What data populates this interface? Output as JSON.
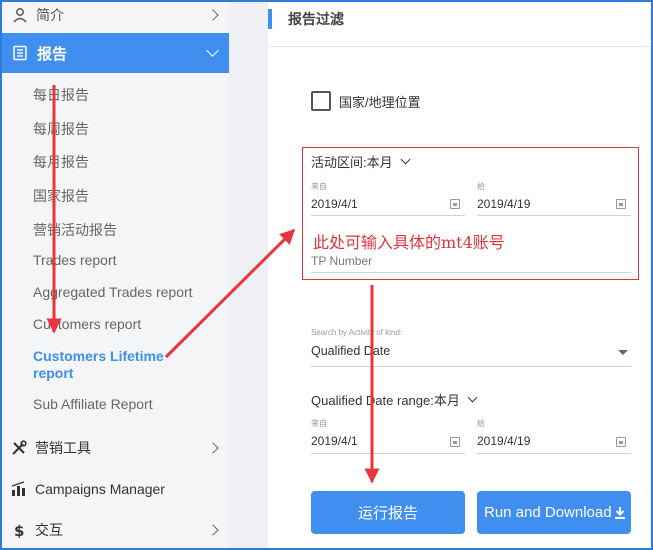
{
  "sidebar": {
    "top_item": {
      "label": "简介",
      "icon": "user-icon"
    },
    "active_item": {
      "label": "报告",
      "icon": "report-icon"
    },
    "sub_items": [
      {
        "label": "每日报告"
      },
      {
        "label": "每周报告"
      },
      {
        "label": "每月报告"
      },
      {
        "label": "国家报告"
      },
      {
        "label": "营销活动报告"
      },
      {
        "label": "Trades report"
      },
      {
        "label": "Aggregated Trades report"
      },
      {
        "label": "Customers report"
      },
      {
        "label": "Customers Lifetime report"
      },
      {
        "label": "Sub Affiliate Report"
      }
    ],
    "bottom_items": [
      {
        "label": "营销工具",
        "icon": "tools-icon"
      },
      {
        "label": "Campaigns Manager",
        "icon": "bar-chart-icon"
      },
      {
        "label": "交互",
        "icon": "dollar-icon"
      }
    ]
  },
  "main": {
    "header_title": "报告过滤",
    "country_checkbox_label": "国家/地理位置",
    "activity_range": {
      "label": "活动区间:本月",
      "from_caption": "来自",
      "from_value": "2019/4/1",
      "to_caption": "给",
      "to_value": "2019/4/19"
    },
    "tp_number": {
      "placeholder": "TP Number"
    },
    "note": "此处可输入具体的mt4账号",
    "activity_kind": {
      "caption": "Search by Activity of kind:",
      "value": "Qualified Date"
    },
    "qualified_range": {
      "label": "Qualified Date range:本月",
      "from_caption": "来自",
      "from_value": "2019/4/1",
      "to_caption": "给",
      "to_value": "2019/4/19"
    },
    "buttons": {
      "run": "运行报告",
      "run_download": "Run and Download"
    }
  },
  "colors": {
    "accent": "#3f8ef0",
    "annotation": "#e0353b",
    "frame": "#2f7cd8"
  }
}
